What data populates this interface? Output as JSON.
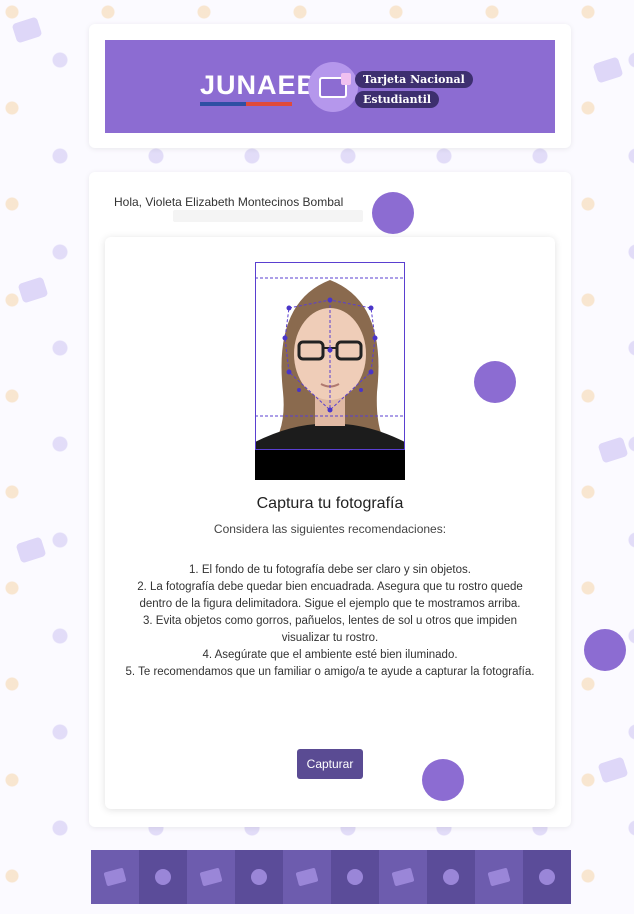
{
  "header": {
    "logo_text": "JUNAEB",
    "badge_icon": "tne-card-icon",
    "tagline_line1": "Tarjeta Nacional",
    "tagline_line2": "Estudiantil"
  },
  "greeting": "Hola, Violeta Elizabeth Montecinos Bombal",
  "capture": {
    "title": "Captura tu fotografía",
    "subtitle": "Considera las siguientes recomendaciones:",
    "recommendations": [
      "1. El fondo de tu fotografía debe ser claro y sin objetos.",
      "2. La fotografía debe quedar bien encuadrada. Asegura que tu rostro quede dentro de la figura delimitadora. Sigue el ejemplo que te mostramos arriba.",
      "3. Evita objetos como gorros, pañuelos, lentes de sol u otros que impiden visualizar tu rostro.",
      "4. Asegúrate que el ambiente esté bien iluminado.",
      "5. Te recomendamos que un familiar o amigo/a te ayude a capturar la fotografía."
    ],
    "button_label": "Capturar"
  },
  "colors": {
    "brand": "#8c6cd2",
    "button": "#5a4b93",
    "footer_dark": "#5b4c99",
    "footer_light": "#6d5cae"
  }
}
